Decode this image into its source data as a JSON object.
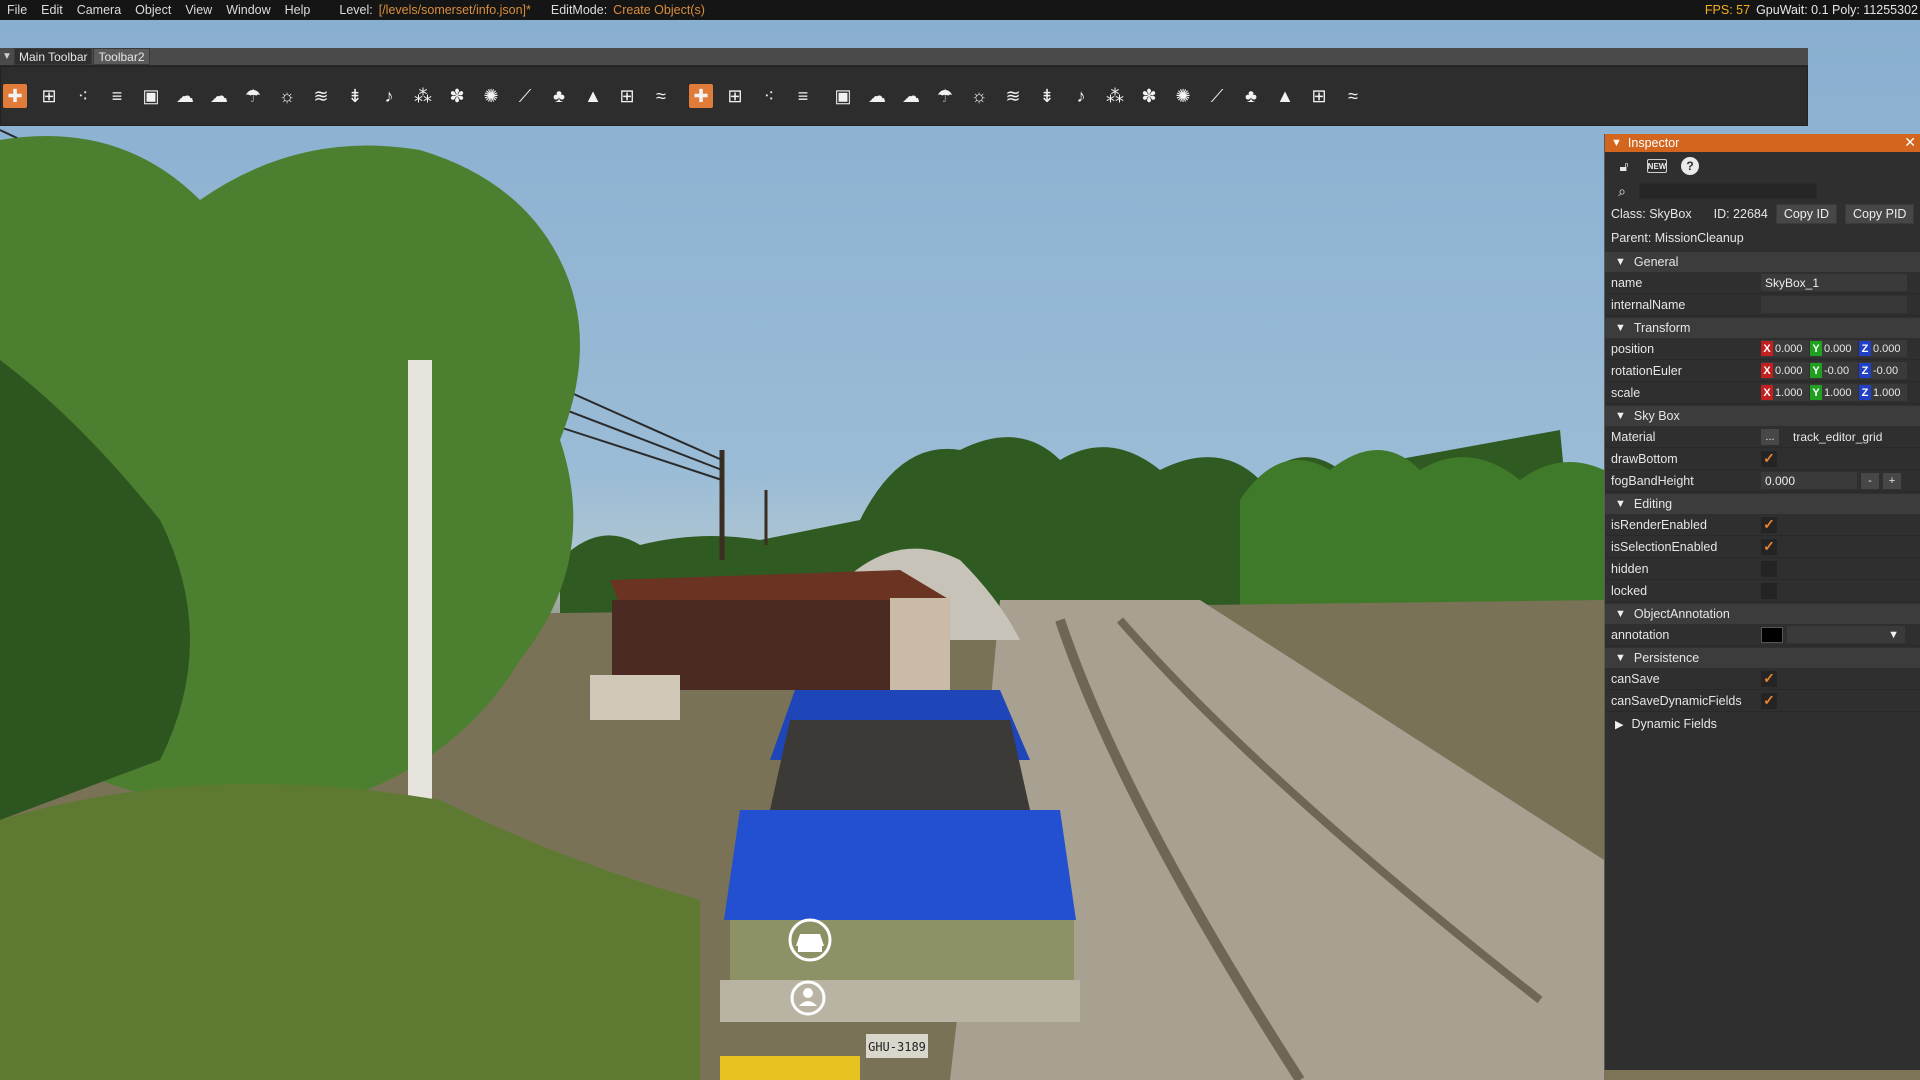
{
  "menubar": {
    "items": [
      "File",
      "Edit",
      "Camera",
      "Object",
      "View",
      "Window",
      "Help"
    ],
    "level_label": "Level:",
    "level_value": "[/levels/somerset/info.json]*",
    "editmode_label": "EditMode:",
    "editmode_value": "Create Object(s)",
    "fps": "FPS: 57",
    "stats_rest": "GpuWait: 0.1  Poly: 11255302"
  },
  "toolbar": {
    "tabs": [
      "Main Toolbar",
      "Toolbar2"
    ],
    "icons": [
      "create-object-icon",
      "add-group-icon",
      "add-node-icon",
      "add-list-icon",
      "image-icon",
      "cloud-icon",
      "cloud-solid-icon",
      "rain-cloud-icon",
      "sun-icon",
      "water-plane-icon",
      "spawn-point-icon",
      "sound-emitter-icon",
      "particle-icon",
      "splash-icon",
      "light-bulb-icon",
      "spotlight-icon",
      "plant-icon",
      "terrain-icon",
      "grid-icon",
      "waves-icon",
      "create-object-icon",
      "add-group-icon",
      "add-node-icon",
      "add-list-icon",
      "image-icon",
      "cloud-icon",
      "cloud-solid-icon",
      "rain-cloud-icon",
      "sun-icon",
      "water-plane-icon",
      "spawn-point-icon",
      "sound-emitter-icon",
      "particle-icon",
      "splash-icon",
      "light-bulb-icon",
      "spotlight-icon",
      "plant-icon",
      "terrain-icon",
      "grid-icon",
      "waves-icon"
    ]
  },
  "inspector": {
    "title": "Inspector",
    "class_text": "Class:  SkyBox",
    "id_text": "ID:  22684",
    "copy_id": "Copy ID",
    "copy_pid": "Copy PID",
    "parent_text": "Parent:  MissionCleanup",
    "sections": {
      "general": "General",
      "transform": "Transform",
      "skybox": "Sky Box",
      "editing": "Editing",
      "annotation": "ObjectAnnotation",
      "persistence": "Persistence",
      "dynamic": "Dynamic Fields"
    },
    "props": {
      "name_label": "name",
      "name_value": "SkyBox_1",
      "internal_label": "internalName",
      "position_label": "position",
      "position": [
        "0.000",
        "0.000",
        "0.000"
      ],
      "rotation_label": "rotationEuler",
      "rotation": [
        "0.000",
        "-0.00",
        "-0.00"
      ],
      "scale_label": "scale",
      "scale": [
        "1.000",
        "1.000",
        "1.000"
      ],
      "material_label": "Material",
      "material_btn": "...",
      "material_value": "track_editor_grid",
      "drawbottom_label": "drawBottom",
      "fog_label": "fogBandHeight",
      "fog_value": "0.000",
      "minus": "-",
      "plus": "+",
      "render_label": "isRenderEnabled",
      "selection_label": "isSelectionEnabled",
      "hidden_label": "hidden",
      "locked_label": "locked",
      "annotation_label": "annotation",
      "cansave_label": "canSave",
      "cansavedyn_label": "canSaveDynamicFields"
    },
    "axis_labels": [
      "X",
      "Y",
      "Z"
    ],
    "checked_mark": "✓"
  },
  "scene": {
    "license_plate": "GHU-3189"
  }
}
